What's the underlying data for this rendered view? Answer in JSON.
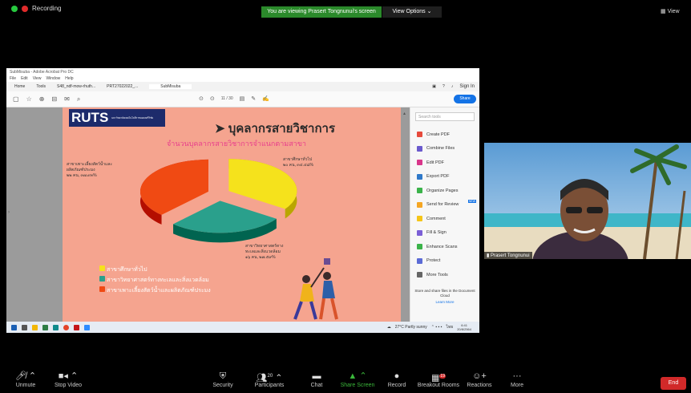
{
  "meeting": {
    "recording_label": "Recording",
    "banner": "You are viewing Prasert Tongnunui's screen",
    "view_options": "View Options",
    "view_label": "View"
  },
  "acrobat": {
    "title": "SubMisuba - Adobe Acrobat Pro DC",
    "menu": [
      "File",
      "Edit",
      "View",
      "Window",
      "Help"
    ],
    "tabs": [
      "Home",
      "Tools",
      "S48_ndf-mow-rhuth...",
      "PRT27022022_...",
      "SubMisuba"
    ],
    "signin": "Sign In",
    "page_info": "11 / 30",
    "share_btn": "Share",
    "search_placeholder": "Search tools",
    "tools": [
      "Create PDF",
      "Combine Files",
      "Edit PDF",
      "Export PDF",
      "Organize Pages",
      "Send for Review",
      "Comment",
      "Fill & Sign",
      "Enhance Scans",
      "Protect",
      "More Tools"
    ],
    "tools_new_badge": "NEW",
    "promo_text": "Store and share files in the Document Cloud",
    "promo_link": "Learn More"
  },
  "slide": {
    "logo_text": "RUTS",
    "logo_sub": "มหาวิทยาลัยเทคโนโลยีราชมงคลศรีวิชัย",
    "title": "บุคลากรสายวิชาการ",
    "subtitle": "จำนวนบุคลากรสายวิชาการจำแนกตามสาขา",
    "legend": [
      {
        "label": "สาขาศึกษาทั่วไป",
        "color": "#f5e21c"
      },
      {
        "label": "สาขาวิทยาศาสตร์ทางทะเลและสิ่งแวดล้อม",
        "color": "#2aa08c"
      },
      {
        "label": "สาขาเพาะเลี้ยงสัตว์น้ำและผลิตภัณฑ์ประมง",
        "color": "#f04a13"
      }
    ],
    "label_right_top": "สาขาศึกษาทั่วไป",
    "label_right_top_val": "๒๐ คน, ๓๔.๔๘%",
    "label_left": "สาขาเพาะเลี้ยงสัตว์น้ำและผลิตภัณฑ์ประมง",
    "label_left_val": "๒๒ คน, ๓๗.๙๓%",
    "label_right_bottom": "สาขาวิทยาศาสตร์ทางทะเลและสิ่งแวดล้อม",
    "label_right_bottom_val": "๑๖ คน, ๒๗.๕๙%"
  },
  "chart_data": {
    "type": "pie",
    "categories": [
      "สาขาศึกษาทั่วไป",
      "สาขาวิทยาศาสตร์ทางทะเลและสิ่งแวดล้อม",
      "สาขาเพาะเลี้ยงสัตว์น้ำและผลิตภัณฑ์ประมง"
    ],
    "values": [
      20,
      16,
      22
    ],
    "percent": [
      34.48,
      27.59,
      37.93
    ],
    "colors": [
      "#f5e21c",
      "#2aa08c",
      "#f04a13"
    ],
    "title": "จำนวนบุคลากรสายวิชาการจำแนกตามสาขา"
  },
  "taskbar": {
    "weather": "27°C Partly sunny",
    "lang": "ไทย",
    "time": "6:41",
    "date": "20/8/2564"
  },
  "camera": {
    "name": "Prasert Tongnunui"
  },
  "toolbar": {
    "items": [
      {
        "label": "Unmute",
        "icon": "mic-muted-icon"
      },
      {
        "label": "Stop Video",
        "icon": "video-icon"
      },
      {
        "label": "Security",
        "icon": "shield-icon"
      },
      {
        "label": "Participants",
        "icon": "participants-icon",
        "count": "20"
      },
      {
        "label": "Chat",
        "icon": "chat-icon"
      },
      {
        "label": "Share Screen",
        "icon": "share-screen-icon"
      },
      {
        "label": "Record",
        "icon": "record-icon"
      },
      {
        "label": "Breakout Rooms",
        "icon": "breakout-rooms-icon",
        "badge": "19"
      },
      {
        "label": "Reactions",
        "icon": "reactions-icon"
      },
      {
        "label": "More",
        "icon": "more-icon"
      }
    ],
    "end": "End"
  },
  "colors": {
    "banner_green": "#2b8a2b",
    "share_green": "#3ab73a",
    "end_red": "#d12929",
    "acrobat_blue": "#1473e6"
  }
}
